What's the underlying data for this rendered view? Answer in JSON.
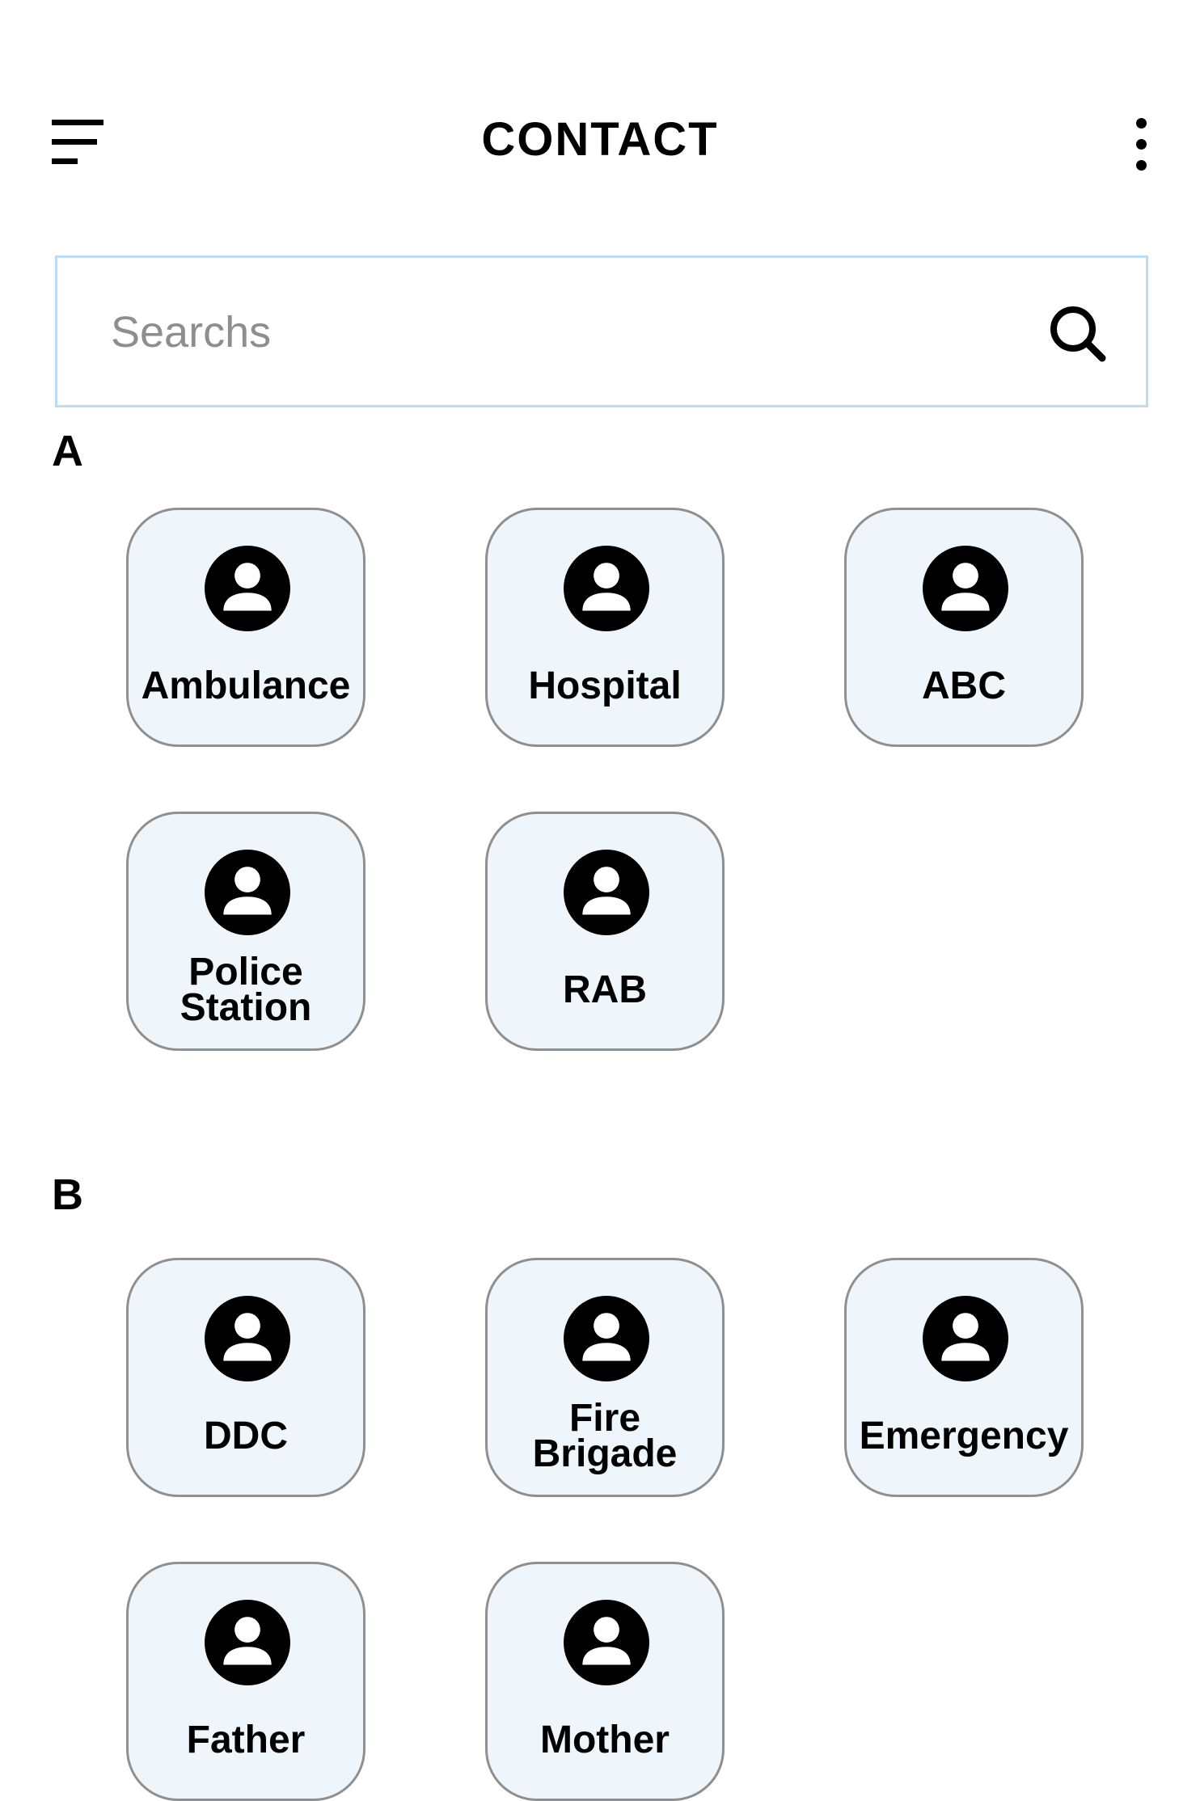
{
  "header": {
    "title": "CONTACT",
    "menu_icon": "menu-icon",
    "more_icon": "more-vertical-icon"
  },
  "search": {
    "placeholder": "Searchs",
    "value": "",
    "icon": "search-icon"
  },
  "sections": [
    {
      "letter": "A",
      "contacts": [
        {
          "name": "Ambulance",
          "icon": "person-icon"
        },
        {
          "name": "Hospital",
          "icon": "person-icon"
        },
        {
          "name": "ABC",
          "icon": "person-icon"
        },
        {
          "name": "Police Station",
          "icon": "person-icon"
        },
        {
          "name": "RAB",
          "icon": "person-icon"
        }
      ]
    },
    {
      "letter": "B",
      "contacts": [
        {
          "name": "DDC",
          "icon": "person-icon"
        },
        {
          "name": "Fire Brigade",
          "icon": "person-icon"
        },
        {
          "name": "Emergency",
          "icon": "person-icon"
        },
        {
          "name": "Father",
          "icon": "person-icon"
        },
        {
          "name": "Mother",
          "icon": "person-icon"
        }
      ]
    }
  ],
  "colors": {
    "card_background": "#eef6fc",
    "card_border": "#8f8f8f",
    "search_border": "#bcdcf6",
    "placeholder": "#8e8e8e",
    "text": "#000000"
  }
}
